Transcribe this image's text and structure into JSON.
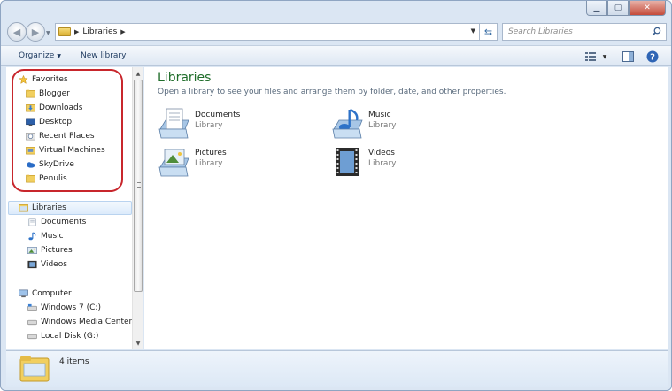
{
  "window": {
    "caption": {
      "minimize": "▁",
      "maximize": "▢",
      "close": "✕"
    }
  },
  "nav": {
    "back_icon": "back-arrow-icon",
    "forward_icon": "forward-arrow-icon",
    "address": {
      "crumbs": [
        "Libraries"
      ]
    },
    "search": {
      "placeholder": "Search Libraries"
    }
  },
  "toolbar": {
    "organize_label": "Organize",
    "new_library_label": "New library"
  },
  "sidebar": {
    "favorites": {
      "label": "Favorites",
      "items": [
        {
          "label": "Blogger",
          "icon": "folder-icon"
        },
        {
          "label": "Downloads",
          "icon": "downloads-folder-icon"
        },
        {
          "label": "Desktop",
          "icon": "desktop-icon"
        },
        {
          "label": "Recent Places",
          "icon": "recent-places-icon"
        },
        {
          "label": "Virtual Machines",
          "icon": "folder-icon"
        },
        {
          "label": "SkyDrive",
          "icon": "skydrive-icon"
        },
        {
          "label": "Penulis",
          "icon": "folder-icon"
        }
      ]
    },
    "libraries": {
      "label": "Libraries",
      "items": [
        {
          "label": "Documents",
          "icon": "documents-icon"
        },
        {
          "label": "Music",
          "icon": "music-icon"
        },
        {
          "label": "Pictures",
          "icon": "pictures-icon"
        },
        {
          "label": "Videos",
          "icon": "videos-icon"
        }
      ]
    },
    "computer": {
      "label": "Computer",
      "items": [
        {
          "label": "Windows 7 (C:)",
          "icon": "drive-icon"
        },
        {
          "label": "Windows Media Center (D",
          "icon": "drive-icon"
        },
        {
          "label": "Local Disk (G:)",
          "icon": "drive-icon"
        }
      ]
    }
  },
  "main": {
    "title": "Libraries",
    "subtitle": "Open a library to see your files and arrange them by folder, date, and other properties.",
    "libraries": [
      {
        "name": "Documents",
        "type": "Library"
      },
      {
        "name": "Music",
        "type": "Library"
      },
      {
        "name": "Pictures",
        "type": "Library"
      },
      {
        "name": "Videos",
        "type": "Library"
      }
    ]
  },
  "details": {
    "count": "4 items"
  },
  "colors": {
    "title_green": "#1f6d2a",
    "highlight_ring": "#c8262c",
    "accent_blue": "#3a6ea5"
  }
}
